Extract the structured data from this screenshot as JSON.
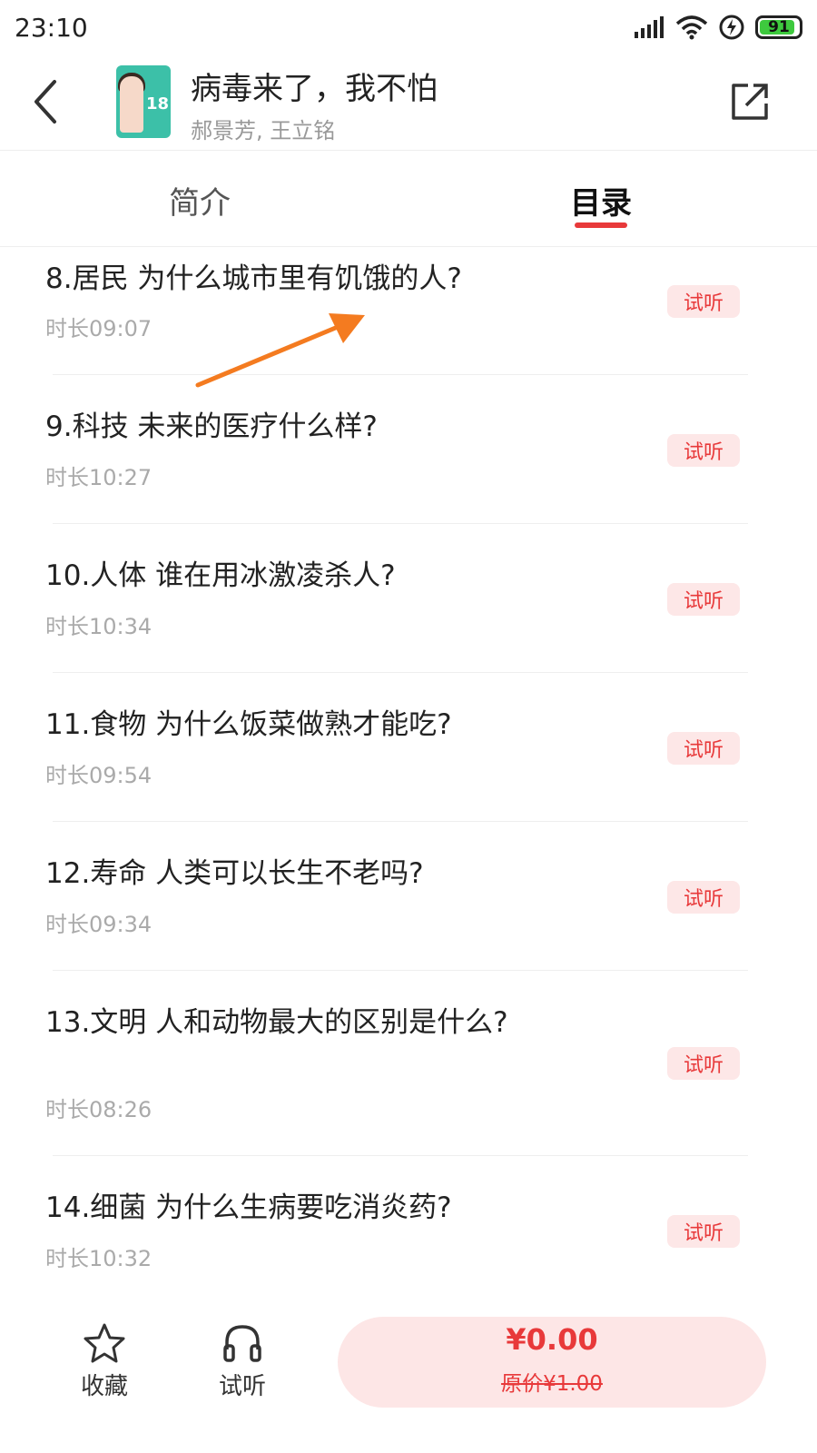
{
  "status_bar": {
    "time": "23:10",
    "battery": "91",
    "icons": [
      "signal-icon",
      "wifi-icon",
      "charging-icon",
      "battery-icon"
    ]
  },
  "header": {
    "title": "病毒来了，我不怕",
    "authors": "郝景芳, 王立铭",
    "cover_badge": "18"
  },
  "tabs": {
    "intro": "简介",
    "catalog": "目录",
    "active": "catalog"
  },
  "episodes": [
    {
      "title": "8.居民  为什么城市里有饥饿的人?",
      "duration": "时长09:07",
      "badge": "试听"
    },
    {
      "title": "9.科技  未来的医疗什么样?",
      "duration": "时长10:27",
      "badge": "试听"
    },
    {
      "title": "10.人体  谁在用冰激凌杀人?",
      "duration": "时长10:34",
      "badge": "试听"
    },
    {
      "title": "11.食物  为什么饭菜做熟才能吃?",
      "duration": "时长09:54",
      "badge": "试听"
    },
    {
      "title": "12.寿命  人类可以长生不老吗?",
      "duration": "时长09:34",
      "badge": "试听"
    },
    {
      "title": "13.文明  人和动物最大的区别是什么?",
      "duration": "时长08:26",
      "badge": "试听"
    },
    {
      "title": "14.细菌  为什么生病要吃消炎药?",
      "duration": "时长10:32",
      "badge": "试听"
    }
  ],
  "bottom_bar": {
    "favorite_label": "收藏",
    "trial_label": "试听",
    "price": "¥0.00",
    "original_price_prefix": "原价",
    "original_price": "¥1.00"
  },
  "colors": {
    "accent": "#e8393a",
    "badge_bg": "#fde7e7",
    "arrow": "#f47b20"
  }
}
